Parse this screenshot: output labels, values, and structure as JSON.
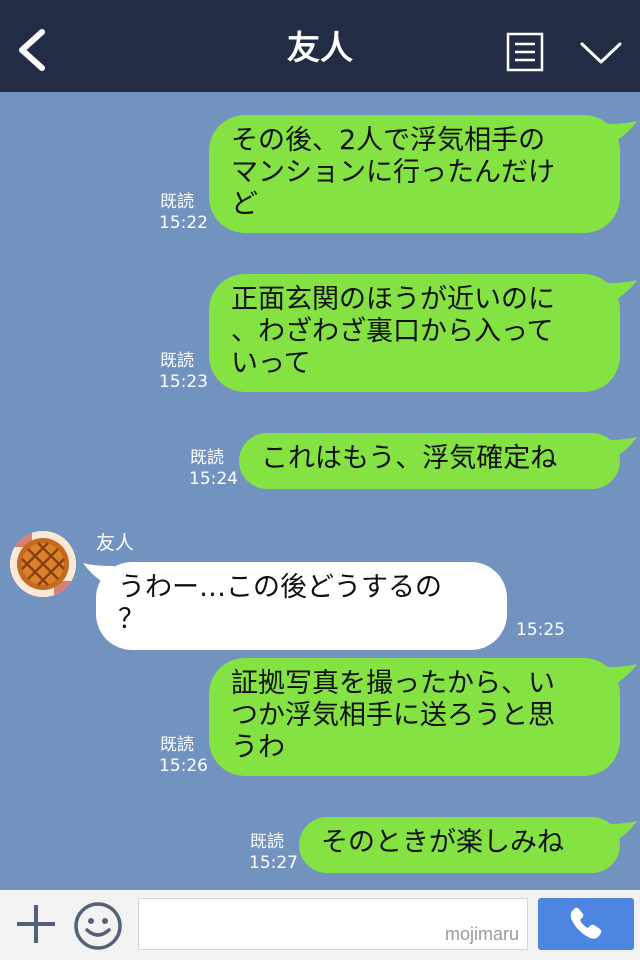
{
  "header": {
    "title": "友人",
    "back_icon": "chevron-left-icon",
    "menu_icon": "note-list-icon",
    "dropdown_icon": "chevron-down-icon"
  },
  "chat": {
    "friend_name": "友人",
    "messages": [
      {
        "side": "out",
        "text": "その後、2人で浮気相手の\nマンションに行ったんだけ\nど",
        "read": "既読",
        "time": "15:22"
      },
      {
        "side": "out",
        "text": "正面玄関のほうが近いのに\n、わざわざ裏口から入って\nいって",
        "read": "既読",
        "time": "15:23"
      },
      {
        "side": "out",
        "text": "これはもう、浮気確定ね",
        "read": "既読",
        "time": "15:24"
      },
      {
        "side": "in",
        "text": "うわー…この後どうするの\n？",
        "time": "15:25"
      },
      {
        "side": "out",
        "text": "証拠写真を撮ったから、い\nつか浮気相手に送ろうと思\nうわ",
        "read": "既読",
        "time": "15:26"
      },
      {
        "side": "out",
        "text": "そのときが楽しみね",
        "read": "既読",
        "time": "15:27"
      }
    ]
  },
  "input_bar": {
    "plus_icon": "plus-icon",
    "emoji_icon": "smiley-icon",
    "field_value": "",
    "watermark": "mojimaru",
    "call_icon": "phone-icon"
  },
  "colors": {
    "header_bg": "#232c45",
    "chat_bg": "#7292c0",
    "outgoing_bubble": "#84e242",
    "incoming_bubble": "#ffffff",
    "call_button": "#4c86e0"
  }
}
